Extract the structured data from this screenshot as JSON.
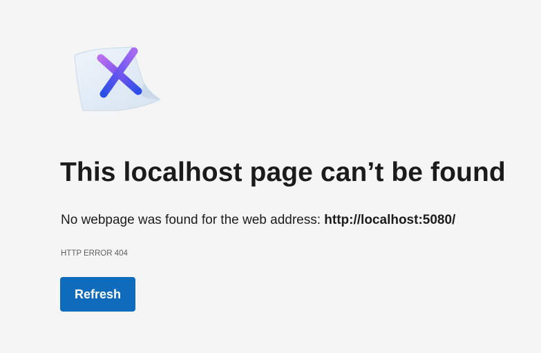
{
  "illustration": {
    "icon": "broken-page-x-icon"
  },
  "title": "This localhost page can’t be found",
  "message": {
    "prefix": "No webpage was found for the web address: ",
    "url": "http://localhost:5080/"
  },
  "error_code": "HTTP ERROR 404",
  "refresh_button": {
    "label": "Refresh"
  },
  "colors": {
    "background": "#f5f5f6",
    "accent": "#0f6cbd",
    "text": "#1b1b1b",
    "muted_text": "#5f5f5f"
  }
}
